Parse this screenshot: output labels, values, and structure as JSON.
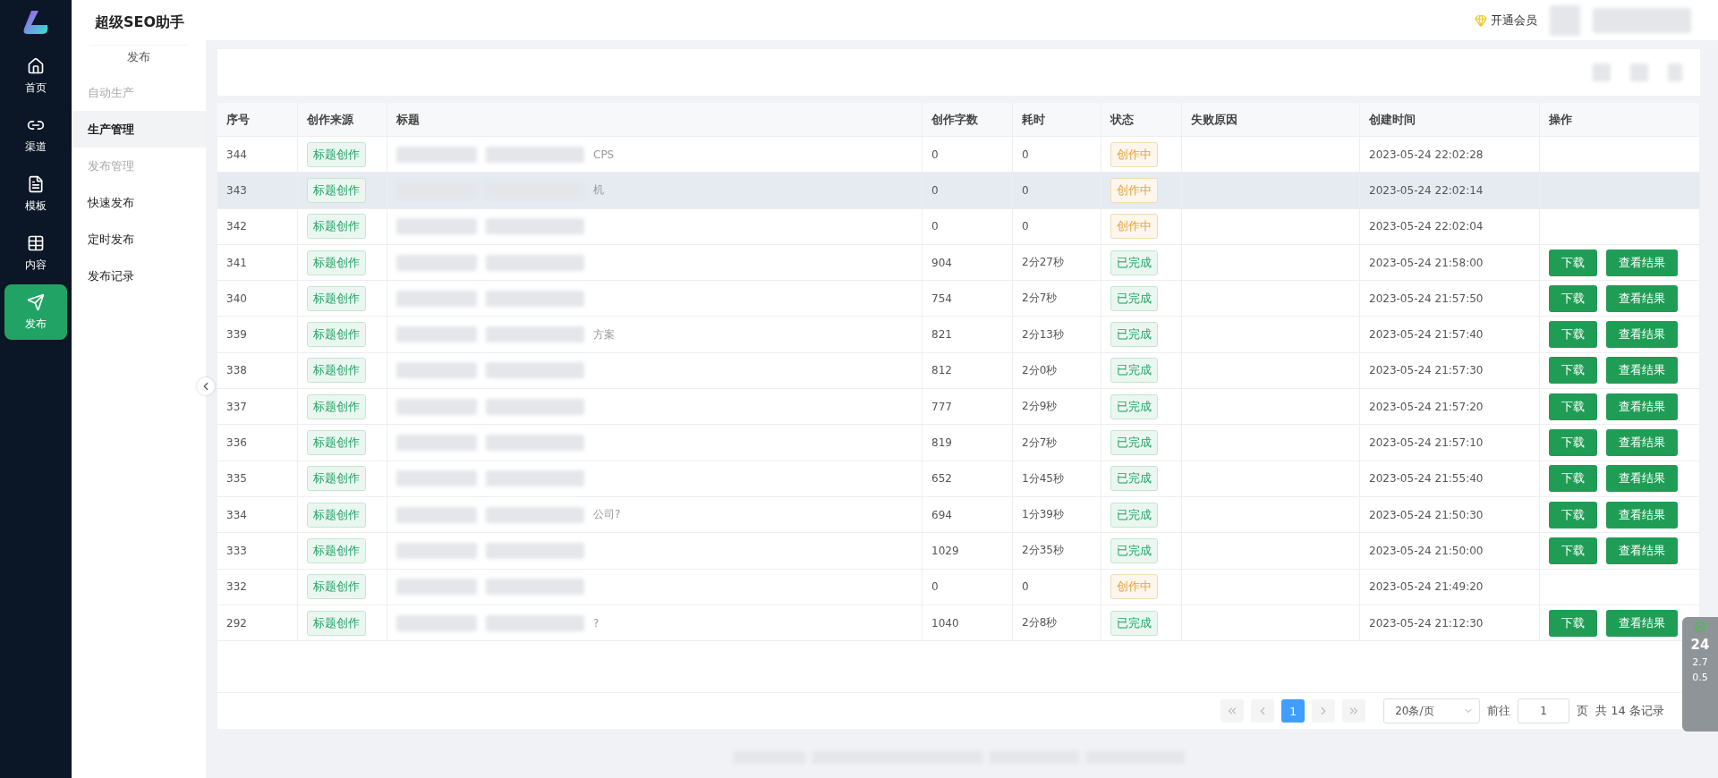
{
  "app": {
    "title": "超级SEO助手"
  },
  "rail": [
    {
      "label": "首页",
      "selected": false
    },
    {
      "label": "渠道",
      "selected": false
    },
    {
      "label": "模板",
      "selected": false
    },
    {
      "label": "内容",
      "selected": false
    },
    {
      "label": "发布",
      "selected": true
    }
  ],
  "subnav": {
    "section": "发布",
    "items": [
      {
        "label": "自动生产",
        "selected": false,
        "disabled": true
      },
      {
        "label": "生产管理",
        "selected": true,
        "disabled": false
      },
      {
        "label": "发布管理",
        "selected": false,
        "disabled": true
      },
      {
        "label": "快速发布",
        "selected": false,
        "disabled": false
      },
      {
        "label": "定时发布",
        "selected": false,
        "disabled": false
      },
      {
        "label": "发布记录",
        "selected": false,
        "disabled": false
      }
    ]
  },
  "header": {
    "vip": "开通会员"
  },
  "table": {
    "columns": [
      "序号",
      "创作来源",
      "标题",
      "创作字数",
      "耗时",
      "状态",
      "失败原因",
      "创建时间",
      "操作"
    ],
    "rows": [
      {
        "id": "344",
        "source": "标题创作",
        "title_visible": "CPS",
        "words": "0",
        "time": "0",
        "status": {
          "kind": "creating",
          "label": "创作中"
        },
        "created": "2023-05-24 22:02:28",
        "selected": false
      },
      {
        "id": "343",
        "source": "标题创作",
        "title_visible": "机",
        "words": "0",
        "time": "0",
        "status": {
          "kind": "creating",
          "label": "创作中"
        },
        "created": "2023-05-24 22:02:14",
        "selected": true
      },
      {
        "id": "342",
        "source": "标题创作",
        "words": "0",
        "time": "0",
        "status": {
          "kind": "creating",
          "label": "创作中"
        },
        "created": "2023-05-24 22:02:04",
        "selected": false
      },
      {
        "id": "341",
        "source": "标题创作",
        "words": "904",
        "time": "2分27秒",
        "status": {
          "kind": "done",
          "label": "已完成"
        },
        "created": "2023-05-24 21:58:00",
        "actions": [
          "下载",
          "查看结果"
        ],
        "selected": false
      },
      {
        "id": "340",
        "source": "标题创作",
        "words": "754",
        "time": "2分7秒",
        "status": {
          "kind": "done",
          "label": "已完成"
        },
        "created": "2023-05-24 21:57:50",
        "actions": [
          "下载",
          "查看结果"
        ],
        "selected": false
      },
      {
        "id": "339",
        "source": "标题创作",
        "title_visible": "方案",
        "words": "821",
        "time": "2分13秒",
        "status": {
          "kind": "done",
          "label": "已完成"
        },
        "created": "2023-05-24 21:57:40",
        "actions": [
          "下载",
          "查看结果"
        ],
        "selected": false
      },
      {
        "id": "338",
        "source": "标题创作",
        "words": "812",
        "time": "2分0秒",
        "status": {
          "kind": "done",
          "label": "已完成"
        },
        "created": "2023-05-24 21:57:30",
        "actions": [
          "下载",
          "查看结果"
        ],
        "selected": false
      },
      {
        "id": "337",
        "source": "标题创作",
        "words": "777",
        "time": "2分9秒",
        "status": {
          "kind": "done",
          "label": "已完成"
        },
        "created": "2023-05-24 21:57:20",
        "actions": [
          "下载",
          "查看结果"
        ],
        "selected": false
      },
      {
        "id": "336",
        "source": "标题创作",
        "words": "819",
        "time": "2分7秒",
        "status": {
          "kind": "done",
          "label": "已完成"
        },
        "created": "2023-05-24 21:57:10",
        "actions": [
          "下载",
          "查看结果"
        ],
        "selected": false
      },
      {
        "id": "335",
        "source": "标题创作",
        "words": "652",
        "time": "1分45秒",
        "status": {
          "kind": "done",
          "label": "已完成"
        },
        "created": "2023-05-24 21:55:40",
        "actions": [
          "下载",
          "查看结果"
        ],
        "selected": false
      },
      {
        "id": "334",
        "source": "标题创作",
        "title_visible": "公司?",
        "words": "694",
        "time": "1分39秒",
        "status": {
          "kind": "done",
          "label": "已完成"
        },
        "created": "2023-05-24 21:50:30",
        "actions": [
          "下载",
          "查看结果"
        ],
        "selected": false
      },
      {
        "id": "333",
        "source": "标题创作",
        "words": "1029",
        "time": "2分35秒",
        "status": {
          "kind": "done",
          "label": "已完成"
        },
        "created": "2023-05-24 21:50:00",
        "actions": [
          "下载",
          "查看结果"
        ],
        "selected": false
      },
      {
        "id": "332",
        "source": "标题创作",
        "words": "0",
        "time": "0",
        "status": {
          "kind": "creating",
          "label": "创作中"
        },
        "created": "2023-05-24 21:49:20",
        "selected": false
      },
      {
        "id": "292",
        "source": "标题创作",
        "title_visible": "?",
        "words": "1040",
        "time": "2分8秒",
        "status": {
          "kind": "done",
          "label": "已完成"
        },
        "created": "2023-05-24 21:12:30",
        "actions": [
          "下载",
          "查看结果"
        ],
        "selected": false
      }
    ]
  },
  "pagination": {
    "pages": [
      {
        "label": "1",
        "selected": true
      }
    ],
    "page_size": "20条/页",
    "goto_label": "前往",
    "goto_value": "1",
    "goto_unit": "页",
    "total": "共 14 条记录"
  },
  "speed_widget": {
    "value": "24",
    "up": "2.7",
    "down": "0.5"
  }
}
